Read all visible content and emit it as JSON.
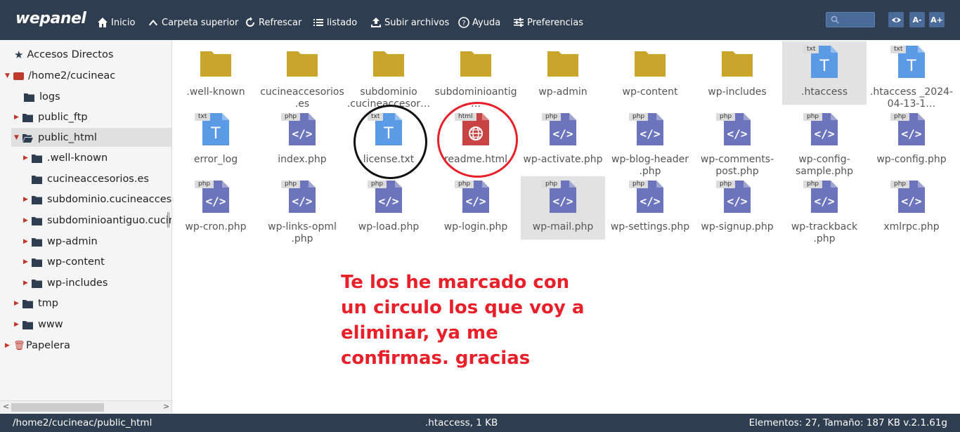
{
  "app": {
    "logo": "wepanel"
  },
  "toolbar": {
    "inicio": "Inicio",
    "carpeta": "Carpeta superior",
    "refrescar": "Refrescar",
    "listado": "listado",
    "subir": "Subir archivos",
    "ayuda": "Ayuda",
    "preferencias": "Preferencias",
    "font_minus": "A-",
    "font_plus": "A+",
    "search_placeholder": ""
  },
  "tree": {
    "accesos": "Accesos Directos",
    "home": "/home2/cucineac",
    "items": [
      "logs",
      "public_ftp",
      "public_html",
      ".well-known",
      "cucineaccesorios.es",
      "subdominio.cucineaccesor",
      "subdominioantiguo.cucine",
      "wp-admin",
      "wp-content",
      "wp-includes",
      "tmp",
      "www",
      "Papelera"
    ]
  },
  "files": [
    {
      "name": ".well-known",
      "type": "folder"
    },
    {
      "name": "cucineaccesorios .es",
      "type": "folder"
    },
    {
      "name": "subdominio .cucineaccesor…",
      "type": "folder"
    },
    {
      "name": "subdominioantig …",
      "type": "folder"
    },
    {
      "name": "wp-admin",
      "type": "folder"
    },
    {
      "name": "wp-content",
      "type": "folder"
    },
    {
      "name": "wp-includes",
      "type": "folder"
    },
    {
      "name": ".htaccess",
      "type": "txt"
    },
    {
      "name": ".htaccess _2024-04-13-1…",
      "type": "txt"
    },
    {
      "name": "error_log",
      "type": "txt"
    },
    {
      "name": "index.php",
      "type": "php"
    },
    {
      "name": "license.txt",
      "type": "txt"
    },
    {
      "name": "readme.html",
      "type": "html"
    },
    {
      "name": "wp-activate.php",
      "type": "php"
    },
    {
      "name": "wp-blog-header .php",
      "type": "php"
    },
    {
      "name": "wp-comments- post.php",
      "type": "php"
    },
    {
      "name": "wp-config- sample.php",
      "type": "php"
    },
    {
      "name": "wp-config.php",
      "type": "php"
    },
    {
      "name": "wp-cron.php",
      "type": "php"
    },
    {
      "name": "wp-links-opml .php",
      "type": "php"
    },
    {
      "name": "wp-load.php",
      "type": "php"
    },
    {
      "name": "wp-login.php",
      "type": "php"
    },
    {
      "name": "wp-mail.php",
      "type": "php"
    },
    {
      "name": "wp-settings.php",
      "type": "php"
    },
    {
      "name": "wp-signup.php",
      "type": "php"
    },
    {
      "name": "wp-trackback .php",
      "type": "php"
    },
    {
      "name": "xmlrpc.php",
      "type": "php"
    }
  ],
  "badges": {
    "txt": "txt",
    "php": "php",
    "html": "html"
  },
  "note": "Te los he marcado con un circulo los que voy a eliminar, ya me confirmas. gracias",
  "status": {
    "path": "/home2/cucineac/public_html",
    "selected": ".htaccess, 1 KB",
    "summary": "Elementos: 27, Tamaño: 187 KB v.2.1.61g"
  },
  "colors": {
    "topbar": "#2e3d4f",
    "folder": "#c9a52c",
    "txt": "#5b9be6",
    "php": "#6c74bb",
    "html": "#c84444",
    "annotation": "#e8202a"
  }
}
